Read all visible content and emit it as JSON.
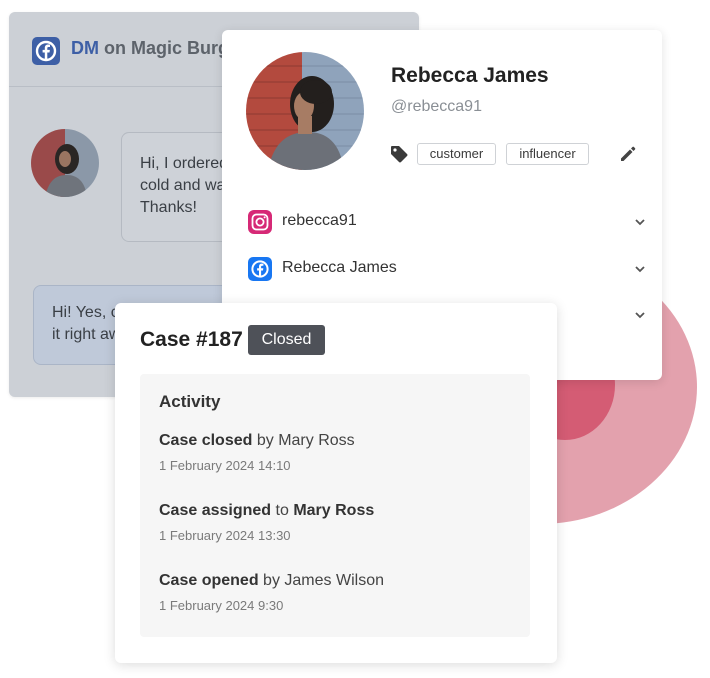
{
  "dm_panel": {
    "prefix": "DM",
    "title_rest": "on Magic Burg",
    "incoming_lines": [
      "Hi, I ordered",
      "cold and wa",
      "Thanks!"
    ],
    "outgoing_lines": [
      "Hi! Yes, c",
      "it right aw"
    ]
  },
  "profile": {
    "name": "Rebecca James",
    "handle": "@rebecca91",
    "tags": [
      "customer",
      "influencer"
    ],
    "accounts": [
      {
        "platform": "instagram-icon",
        "label": "rebecca91"
      },
      {
        "platform": "facebook-icon",
        "label": "Rebecca James"
      },
      {
        "platform": "unknown",
        "label": ""
      }
    ]
  },
  "case": {
    "title": "Case #187",
    "status": "Closed",
    "activity_title": "Activity",
    "activities": [
      {
        "action": "Case closed",
        "connector": "by",
        "actor": "Mary Ross",
        "actor_bold": false,
        "time": "1 February 2024 14:10"
      },
      {
        "action": "Case assigned",
        "connector": "to",
        "actor": "Mary Ross",
        "actor_bold": true,
        "time": "1 February 2024 13:30"
      },
      {
        "action": "Case opened",
        "connector": "by",
        "actor": "James Wilson",
        "actor_bold": false,
        "time": "1 February 2024 9:30"
      }
    ]
  },
  "colors": {
    "facebook": "#1877f2",
    "instagram": "#d62976",
    "status_badge": "#4e5158",
    "accent_circle": "#e3a1ad",
    "accent_circle_inner": "#d45c74"
  }
}
